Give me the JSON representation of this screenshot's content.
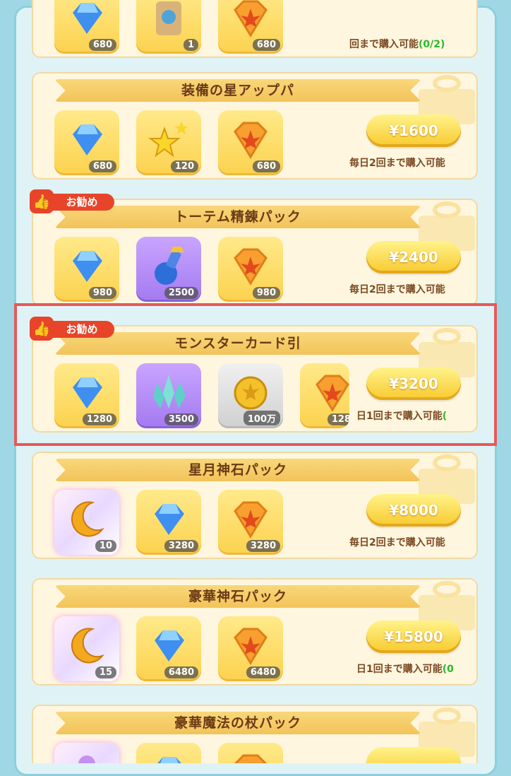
{
  "packs": [
    {
      "title": "",
      "items": [
        {
          "icon": "blue-gem",
          "qty": "680"
        },
        {
          "icon": "totem",
          "qty": "1"
        },
        {
          "icon": "maple-gem",
          "qty": "680"
        }
      ],
      "price": "",
      "limit": "回まで購入可能",
      "limit_count": "(0/2)"
    },
    {
      "title": "装備の星アップパ",
      "items": [
        {
          "icon": "blue-gem",
          "qty": "680"
        },
        {
          "icon": "star",
          "qty": "120"
        },
        {
          "icon": "maple-gem",
          "qty": "680"
        }
      ],
      "price": "¥1600",
      "limit": "毎日2回まで購入可能",
      "limit_count": ""
    },
    {
      "title": "トーテム精錬パック",
      "badge": "お勧め",
      "items": [
        {
          "icon": "blue-gem",
          "qty": "980"
        },
        {
          "icon": "potion",
          "qty": "2500"
        },
        {
          "icon": "maple-gem",
          "qty": "980"
        }
      ],
      "price": "¥2400",
      "limit": "毎日2回まで購入可能",
      "limit_count": ""
    },
    {
      "title": "モンスターカード引",
      "badge": "お勧め",
      "items": [
        {
          "icon": "blue-gem",
          "qty": "1280"
        },
        {
          "icon": "crystal",
          "qty": "3500"
        },
        {
          "icon": "gold-coin",
          "qty": "100万"
        },
        {
          "icon": "maple-gem",
          "qty": "128"
        }
      ],
      "price": "¥3200",
      "limit": "日1回まで購入可能",
      "limit_count": "("
    },
    {
      "title": "星月神石パック",
      "items": [
        {
          "icon": "moon",
          "qty": "10"
        },
        {
          "icon": "blue-gem",
          "qty": "3280"
        },
        {
          "icon": "maple-gem",
          "qty": "3280"
        }
      ],
      "price": "¥8000",
      "limit": "毎日2回まで購入可能",
      "limit_count": ""
    },
    {
      "title": "豪華神石パック",
      "items": [
        {
          "icon": "moon",
          "qty": "15"
        },
        {
          "icon": "blue-gem",
          "qty": "6480"
        },
        {
          "icon": "maple-gem",
          "qty": "6480"
        }
      ],
      "price": "¥15800",
      "limit": "日1回まで購入可能",
      "limit_count": "(0"
    },
    {
      "title": "豪華魔法の杖パック",
      "items": [
        {
          "icon": "staff",
          "qty": ""
        },
        {
          "icon": "blue-gem",
          "qty": ""
        },
        {
          "icon": "maple-gem",
          "qty": ""
        }
      ],
      "price": "",
      "limit": "",
      "limit_count": ""
    }
  ]
}
